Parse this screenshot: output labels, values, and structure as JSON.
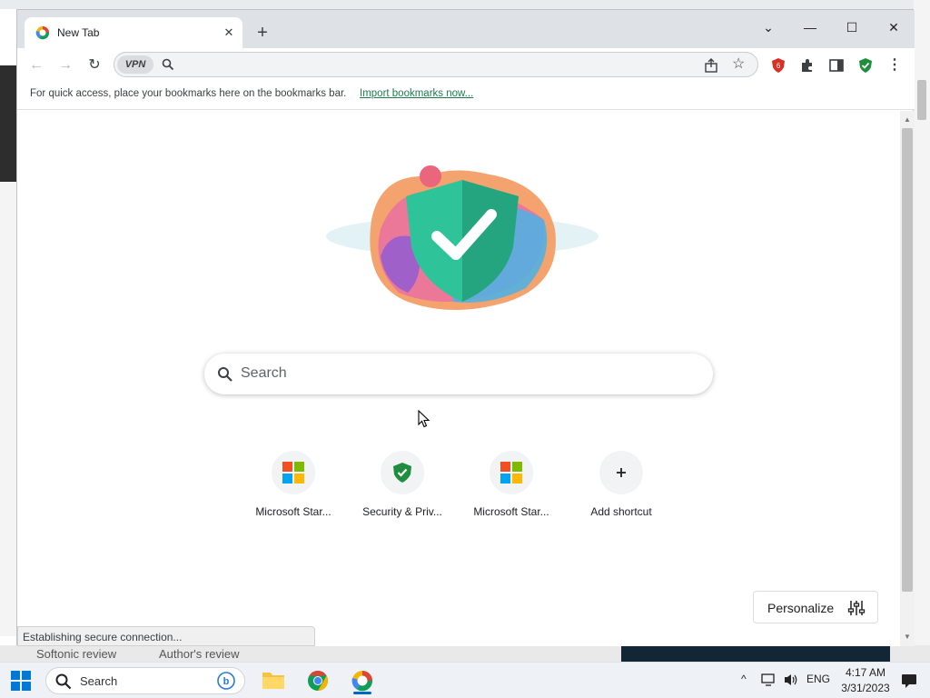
{
  "background": {
    "bottom_left_text": "Softonic review",
    "bottom_mid_text": "Author's review"
  },
  "browser": {
    "tab": {
      "title": "New Tab",
      "close_glyph": "✕"
    },
    "new_tab_glyph": "+",
    "window_controls": {
      "dropdown": "⌄",
      "minimize": "—",
      "maximize": "☐",
      "close": "✕"
    },
    "toolbar": {
      "back": "←",
      "forward": "→",
      "reload": "↻",
      "vpn_label": "VPN",
      "omnibox_value": "",
      "menu": "⋮"
    },
    "bookmarks_bar": {
      "hint": "For quick access, place your bookmarks here on the bookmarks bar.",
      "import_link": "Import bookmarks now..."
    },
    "new_tab_page": {
      "search_placeholder": "Search",
      "shortcuts": [
        {
          "label": "Microsoft Star...",
          "icon": "microsoft-logo-icon"
        },
        {
          "label": "Security & Priv...",
          "icon": "shield-check-icon"
        },
        {
          "label": "Microsoft Star...",
          "icon": "microsoft-logo-icon"
        },
        {
          "label": "Add shortcut",
          "icon": "plus-icon"
        }
      ],
      "personalize_label": "Personalize"
    },
    "status_bar": {
      "text": "Establishing secure connection..."
    }
  },
  "taskbar": {
    "search_label": "Search",
    "tray": {
      "language": "ENG",
      "chevron": "^"
    },
    "clock": {
      "time": "4:17 AM",
      "date": "3/31/2023"
    }
  },
  "colors": {
    "accent": "#1a73e8",
    "shield_green": "#1e8e3e",
    "shield_red": "#d93025",
    "taskbar_accent": "#0067c0"
  }
}
